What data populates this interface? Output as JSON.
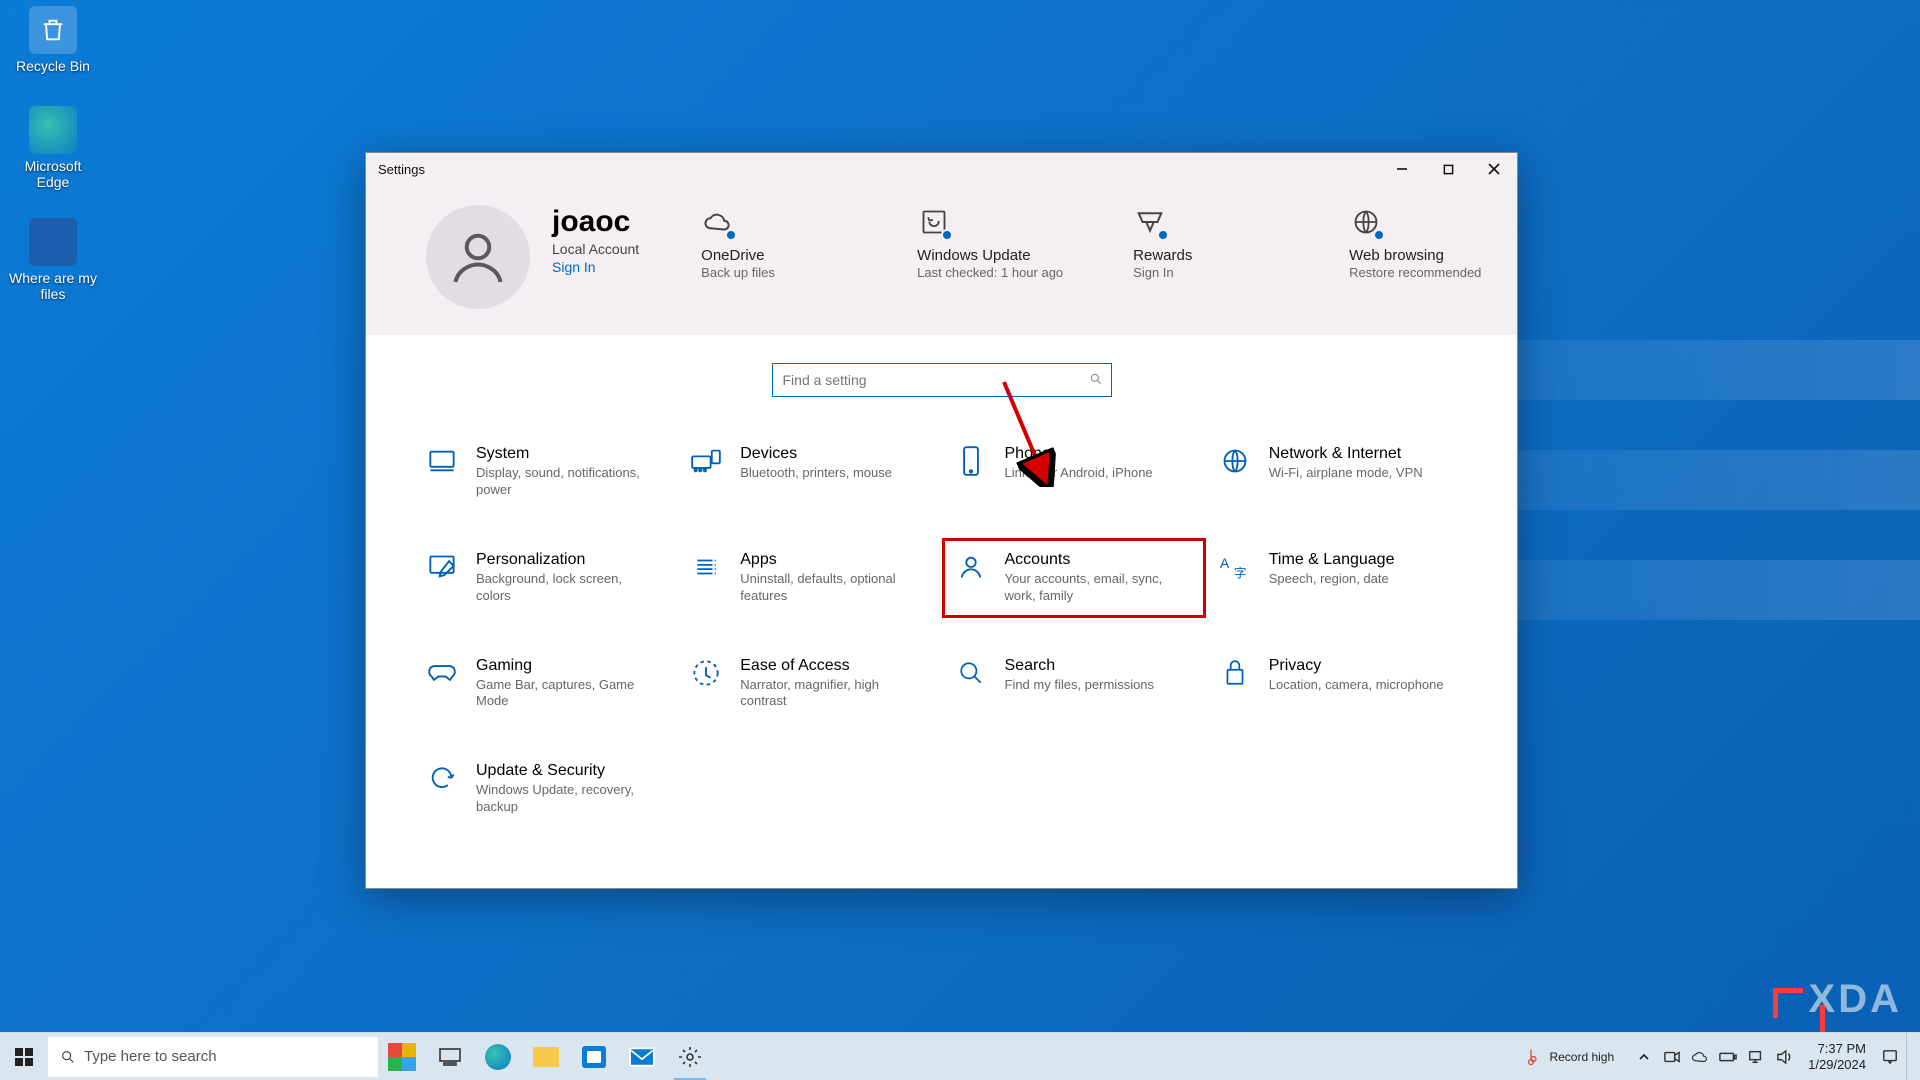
{
  "desktop": {
    "icons": [
      {
        "label": "Recycle Bin"
      },
      {
        "label": "Microsoft Edge"
      },
      {
        "label": "Where are my files"
      }
    ]
  },
  "window": {
    "title": "Settings",
    "user": {
      "name": "joaoc",
      "account_type": "Local Account",
      "sign_in": "Sign In"
    },
    "status_cards": [
      {
        "title": "OneDrive",
        "sub": "Back up files"
      },
      {
        "title": "Windows Update",
        "sub": "Last checked: 1 hour ago"
      },
      {
        "title": "Rewards",
        "sub": "Sign In"
      },
      {
        "title": "Web browsing",
        "sub": "Restore recommended"
      }
    ],
    "search_placeholder": "Find a setting",
    "categories": [
      {
        "title": "System",
        "sub": "Display, sound, notifications, power"
      },
      {
        "title": "Devices",
        "sub": "Bluetooth, printers, mouse"
      },
      {
        "title": "Phone",
        "sub": "Link your Android, iPhone"
      },
      {
        "title": "Network & Internet",
        "sub": "Wi-Fi, airplane mode, VPN"
      },
      {
        "title": "Personalization",
        "sub": "Background, lock screen, colors"
      },
      {
        "title": "Apps",
        "sub": "Uninstall, defaults, optional features"
      },
      {
        "title": "Accounts",
        "sub": "Your accounts, email, sync, work, family",
        "highlight": true
      },
      {
        "title": "Time & Language",
        "sub": "Speech, region, date"
      },
      {
        "title": "Gaming",
        "sub": "Game Bar, captures, Game Mode"
      },
      {
        "title": "Ease of Access",
        "sub": "Narrator, magnifier, high contrast"
      },
      {
        "title": "Search",
        "sub": "Find my files, permissions"
      },
      {
        "title": "Privacy",
        "sub": "Location, camera, microphone"
      },
      {
        "title": "Update & Security",
        "sub": "Windows Update, recovery, backup"
      }
    ]
  },
  "taskbar": {
    "search_placeholder": "Type here to search",
    "weather": "Record high",
    "time": "7:37 PM",
    "date": "1/29/2024"
  },
  "watermark": "XDA"
}
